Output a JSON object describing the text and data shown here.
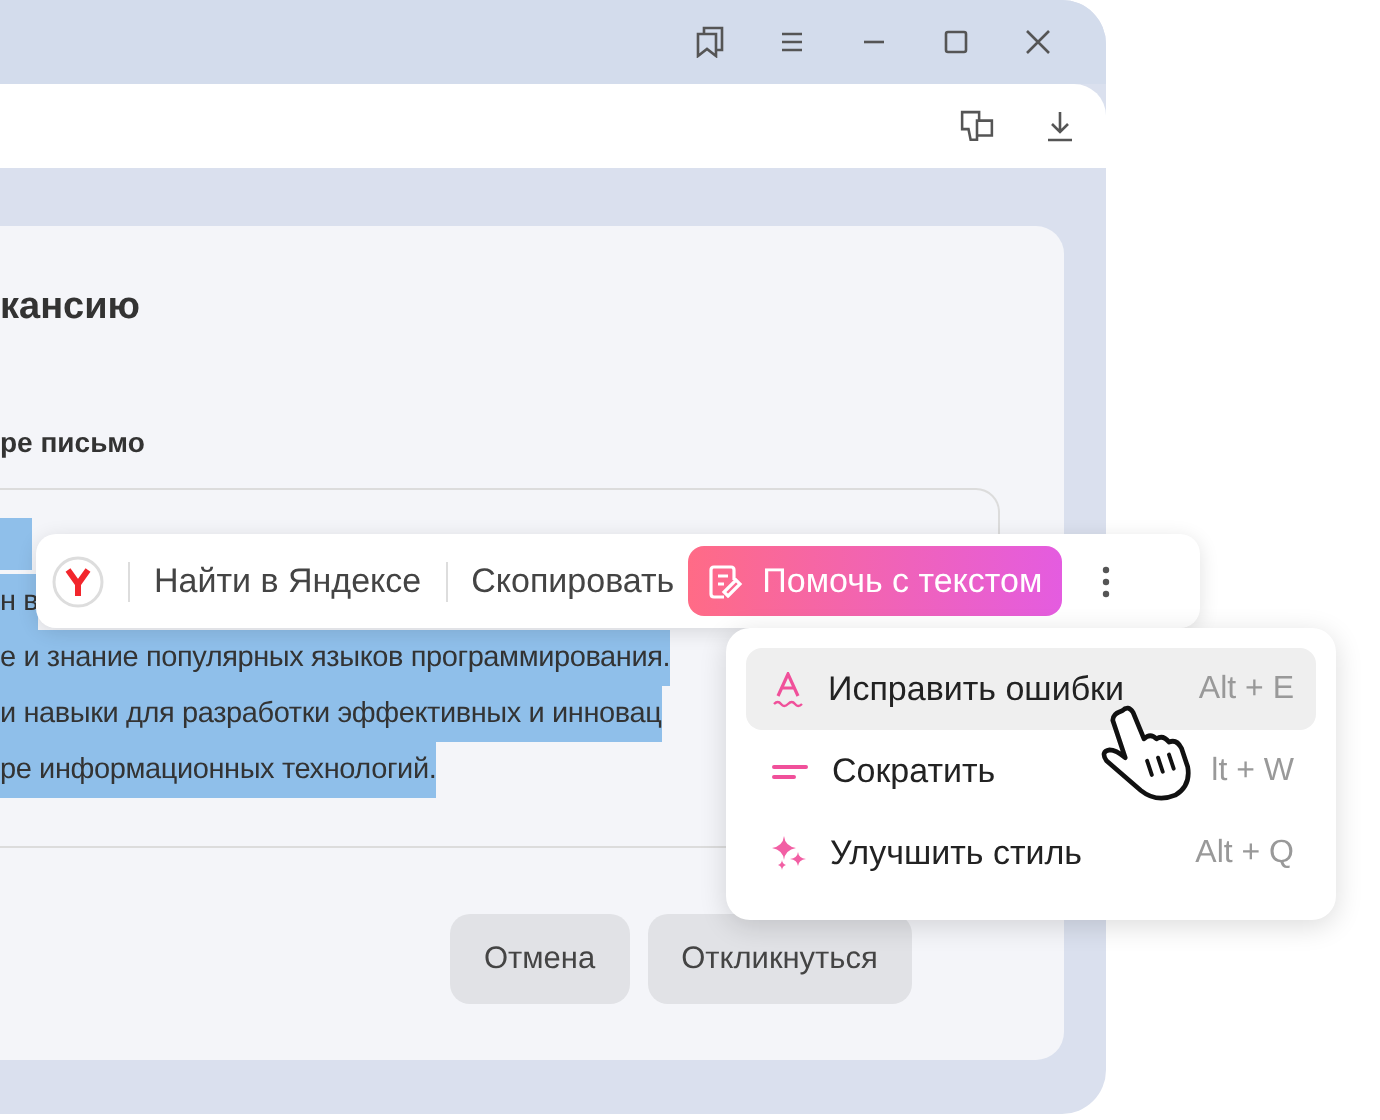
{
  "form": {
    "title": "кансию",
    "field_label": "ре письмо",
    "text_lines": [
      "н в",
      "е и знание популярных языков программирования.",
      "и навыки для разработки эффективных и инновац",
      "ре информационных технологий."
    ],
    "buttons": [
      "Отмена",
      "Откликнуться"
    ]
  },
  "selection_toolbar": {
    "search": "Найти в Яндексе",
    "copy": "Скопировать",
    "assist": "Помочь с текстом"
  },
  "assist_menu": [
    {
      "kind": "fix",
      "label": "Исправить ошибки",
      "shortcut": "Alt + E",
      "selected": true
    },
    {
      "kind": "shorten",
      "label": "Сократить",
      "shortcut": "lt + W",
      "selected": false
    },
    {
      "kind": "style",
      "label": "Улучшить стиль",
      "shortcut": "Alt + Q",
      "selected": false
    }
  ]
}
